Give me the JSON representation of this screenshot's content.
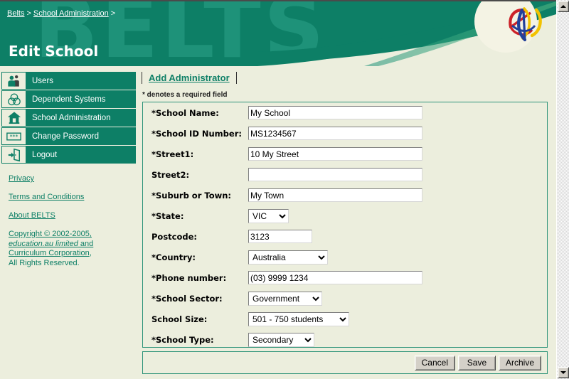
{
  "header": {
    "watermark": "BELTS",
    "title": "Edit School",
    "breadcrumb": [
      {
        "label": "Belts",
        "link": true
      },
      {
        "label": ">",
        "link": false
      },
      {
        "label": "School Administration",
        "link": true
      },
      {
        "label": ">",
        "link": false
      }
    ],
    "logo_colors": {
      "red": "#cc2229",
      "blue": "#22409a",
      "yellow": "#f2c200"
    },
    "background": "#0d7f66",
    "watermark_color": "#1e9279",
    "swoosh_color": "#eceedd"
  },
  "sidebar": {
    "items": [
      {
        "label": "Users",
        "icon": "users-icon"
      },
      {
        "label": "Dependent Systems",
        "icon": "venn-circles-icon"
      },
      {
        "label": "School Administration",
        "icon": "house-icon"
      },
      {
        "label": "Change Password",
        "icon": "password-keypad-icon"
      },
      {
        "label": "Logout",
        "icon": "exit-door-icon"
      }
    ],
    "links": [
      "Privacy",
      "Terms and Conditions",
      "About BELTS"
    ],
    "copyright": {
      "line1": "Copyright © 2002-2005,",
      "line2_italic": "education.au limited",
      "line2_tail": " and",
      "line3": "Curriculum Corporation",
      "line3_tail": ",",
      "line4": "All Rights Reserved."
    },
    "accent_color": "#0d7f66"
  },
  "content": {
    "tab_label": "Add Administrator",
    "required_note": "* denotes a required field",
    "fields": [
      {
        "label": "*School Name:",
        "type": "text",
        "value": "My School",
        "width_class": "w-wide"
      },
      {
        "label": "*School ID Number:",
        "type": "text",
        "value": "MS1234567",
        "width_class": "w-wide"
      },
      {
        "label": "*Street1:",
        "type": "text",
        "value": "10 My Street",
        "width_class": "w-wide"
      },
      {
        "label": "Street2:",
        "type": "text",
        "value": "",
        "width_class": "w-wide"
      },
      {
        "label": "*Suburb or Town:",
        "type": "text",
        "value": "My Town",
        "width_class": "w-wide"
      },
      {
        "label": "*State:",
        "type": "select",
        "value": "VIC",
        "width_class": "w-state"
      },
      {
        "label": "Postcode:",
        "type": "text",
        "value": "3123",
        "width_class": "w-small"
      },
      {
        "label": "*Country:",
        "type": "select",
        "value": "Australia",
        "width_class": "w-country"
      },
      {
        "label": "*Phone number:",
        "type": "text",
        "value": "(03) 9999 1234",
        "width_class": "w-wide"
      },
      {
        "label": "*School Sector:",
        "type": "select",
        "value": "Government",
        "width_class": "w-sector"
      },
      {
        "label": "School Size:",
        "type": "select",
        "value": "501 - 750 students",
        "width_class": "w-size"
      },
      {
        "label": "*School Type:",
        "type": "select",
        "value": "Secondary",
        "width_class": "w-type"
      }
    ],
    "buttons": [
      "Cancel",
      "Save",
      "Archive"
    ],
    "panel_border_color": "#2e9479",
    "panel_background": "#eceedd"
  },
  "scrollbar": {
    "up_icon": "scroll-up-arrow-icon",
    "down_icon": "scroll-down-arrow-icon"
  }
}
